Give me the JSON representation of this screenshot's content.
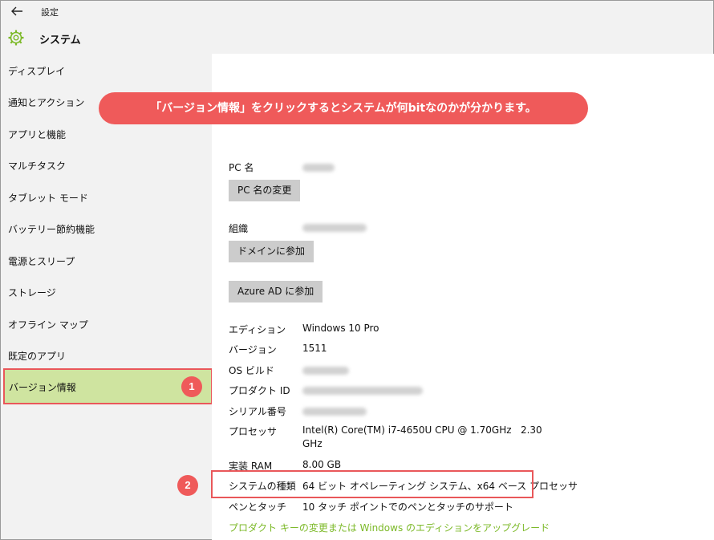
{
  "window": {
    "title": "設定"
  },
  "section": {
    "title": "システム"
  },
  "sidebar": {
    "items": [
      {
        "label": "ディスプレイ"
      },
      {
        "label": "通知とアクション"
      },
      {
        "label": "アプリと機能"
      },
      {
        "label": "マルチタスク"
      },
      {
        "label": "タブレット モード"
      },
      {
        "label": "バッテリー節約機能"
      },
      {
        "label": "電源とスリープ"
      },
      {
        "label": "ストレージ"
      },
      {
        "label": "オフライン マップ"
      },
      {
        "label": "既定のアプリ"
      },
      {
        "label": "バージョン情報"
      }
    ]
  },
  "annotations": {
    "banner": "「バージョン情報」をクリックするとシステムが何bitなのかが分かります。",
    "badge1": "1",
    "badge2": "2"
  },
  "main": {
    "pc_name_label": "PC 名",
    "rename_button": "PC 名の変更",
    "org_label": "組織",
    "join_domain_button": "ドメインに参加",
    "join_azure_button": "Azure AD に参加",
    "edition_label": "エディション",
    "edition_value": "Windows 10 Pro",
    "version_label": "バージョン",
    "version_value": "1511",
    "build_label": "OS ビルド",
    "product_id_label": "プロダクト ID",
    "serial_label": "シリアル番号",
    "processor_label": "プロセッサ",
    "processor_value": "Intel(R) Core(TM) i7-4650U CPU @ 1.70GHz   2.30",
    "processor_value_2": "GHz",
    "ram_label": "実装 RAM",
    "ram_value": "8.00 GB",
    "system_type_label": "システムの種類",
    "system_type_value": "64 ビット オペレーティング システム、x64 ベース プロセッサ",
    "pen_label": "ペンとタッチ",
    "pen_value": "10 タッチ ポイントでのペンとタッチのサポート",
    "upgrade_link": "プロダクト キーの変更または Windows のエディションをアップグレード"
  },
  "colors": {
    "accent": "#7cb928",
    "annotation": "#ef5a5a",
    "active_bg": "#cfe4a0"
  }
}
